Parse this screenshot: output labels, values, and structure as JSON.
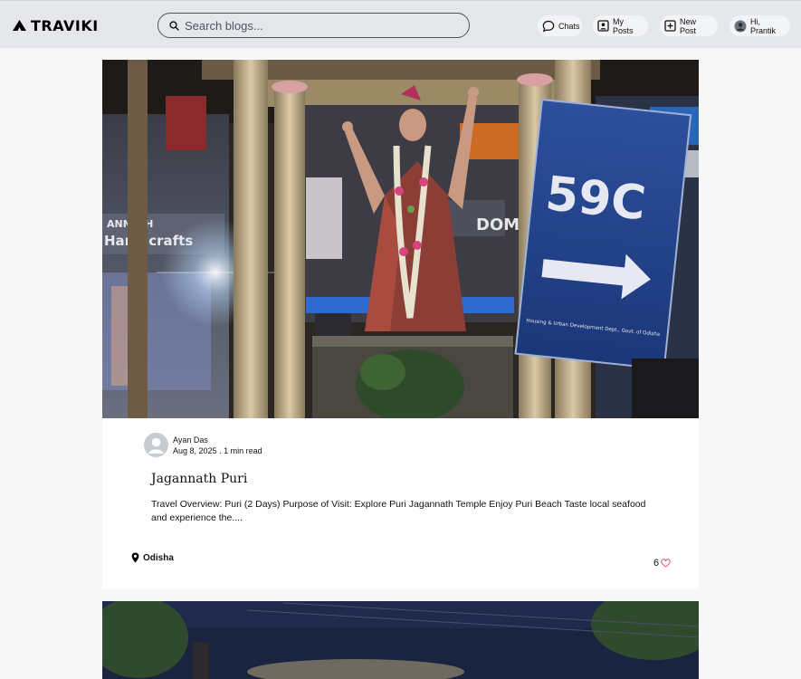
{
  "app": {
    "logo_text": "TRAVIKI"
  },
  "search": {
    "placeholder": "Search blogs...",
    "value": ""
  },
  "nav": {
    "chats_label": "Chats",
    "my_posts_label": "My Posts",
    "new_post_label": "New Post",
    "user_label": "Hi, Prantik"
  },
  "posts": [
    {
      "author": "Ayan Das",
      "date": "Aug 8, 2025",
      "read_time": "1 min read",
      "title": "Jagannath Puri",
      "excerpt": "Travel Overview: Puri (2 Days) Purpose of Visit: Explore Puri Jagannath Temple Enjoy Puri Beach Taste local seafood and experience the....",
      "location": "Odisha",
      "likes": "6",
      "image_signage": {
        "shop_left": "ANNATH",
        "shop_left_2": "Handicrafts",
        "sign_number": "59C",
        "sign_caption": "Housing & Urban Development Dept., Govt. of Odisha",
        "shop_right": "DOM"
      }
    }
  ],
  "colors": {
    "header_bg": "#e5e7eb",
    "page_bg": "#f7f7f7",
    "card_bg": "#ffffff",
    "heart": "#e0507a",
    "sign_blue": "#1f3f8f"
  }
}
